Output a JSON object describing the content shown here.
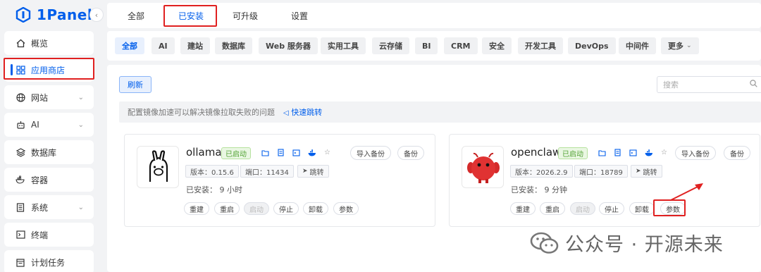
{
  "app": {
    "logo_text": "1Panel"
  },
  "sidebar": {
    "items": [
      {
        "label": "概览",
        "icon": "home-icon"
      },
      {
        "label": "应用商店",
        "icon": "grid-icon",
        "active": true
      },
      {
        "label": "网站",
        "icon": "globe-icon"
      },
      {
        "label": "AI",
        "icon": "robot-icon"
      },
      {
        "label": "数据库",
        "icon": "layers-icon"
      },
      {
        "label": "容器",
        "icon": "docker-icon"
      },
      {
        "label": "系统",
        "icon": "file-icon"
      },
      {
        "label": "终端",
        "icon": "terminal-icon"
      },
      {
        "label": "计划任务",
        "icon": "calendar-icon"
      }
    ]
  },
  "top_tabs": [
    "全部",
    "已安装",
    "可升级",
    "设置"
  ],
  "categories": [
    "全部",
    "AI",
    "建站",
    "数据库",
    "Web 服务器",
    "实用工具",
    "云存储",
    "BI",
    "CRM",
    "安全",
    "开发工具",
    "DevOps",
    "中间件",
    "更多"
  ],
  "toolbar": {
    "refresh_label": "刷新",
    "search_placeholder": "搜索"
  },
  "notice": {
    "text": "配置镜像加速可以解决镜像拉取失败的问题",
    "link": "快速跳转"
  },
  "apps": [
    {
      "name": "ollama",
      "status": "已启动",
      "version": "版本：0.15.6",
      "port": "端口：11434",
      "jump": "跳转",
      "installed": "已安装：  9 小时",
      "import_backup": "导入备份",
      "backup": "备份",
      "actions": [
        "重建",
        "重启",
        "启动",
        "停止",
        "卸载",
        "参数"
      ]
    },
    {
      "name": "openclaw",
      "status": "已启动",
      "version": "版本：2026.2.9",
      "port": "端口：18789",
      "jump": "跳转",
      "installed": "已安装：  9 分钟",
      "import_backup": "导入备份",
      "backup": "备份",
      "actions": [
        "重建",
        "重启",
        "启动",
        "停止",
        "卸载",
        "参数"
      ]
    }
  ],
  "watermark": "公众号 · 开源未来",
  "colors": {
    "accent": "#005eeb",
    "highlight": "#e02020",
    "status_green": "#52a334"
  }
}
